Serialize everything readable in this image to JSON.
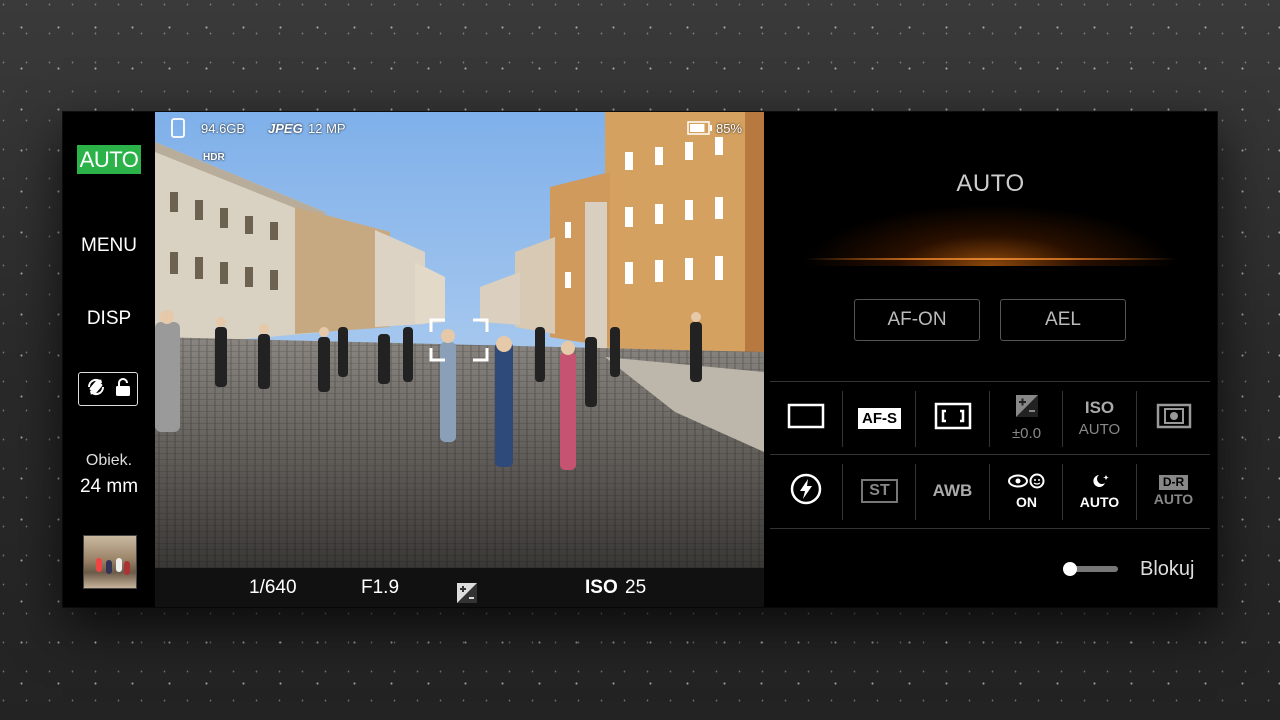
{
  "left": {
    "mode": "AUTO",
    "menu": "MENU",
    "disp": "DISP",
    "lens_label": "Obiek.",
    "lens_value": "24 mm"
  },
  "hud": {
    "storage": "94.6GB",
    "format": "JPEG",
    "resolution": "12 MP",
    "hdr": "HDR",
    "battery": "85%",
    "battery_level": 0.85
  },
  "bottom": {
    "shutter": "1/640",
    "aperture": "F1.9",
    "iso_label": "ISO",
    "iso_value": "25"
  },
  "right": {
    "title": "AUTO",
    "af_on": "AF-ON",
    "ael": "AEL",
    "row1": [
      {
        "name": "drive-mode",
        "icon": "single-frame-icon"
      },
      {
        "name": "focus-mode",
        "label": "AF-S"
      },
      {
        "name": "focus-area",
        "icon": "focus-area-icon"
      },
      {
        "name": "exposure-comp",
        "icon": "exposure-comp-icon",
        "sub": "±0.0"
      },
      {
        "name": "iso",
        "label": "ISO",
        "sub": "AUTO"
      },
      {
        "name": "metering",
        "icon": "metering-icon"
      }
    ],
    "row2": [
      {
        "name": "flash",
        "icon": "flash-icon"
      },
      {
        "name": "style",
        "label": "ST"
      },
      {
        "name": "white-balance",
        "label": "AWB"
      },
      {
        "name": "face-eye",
        "label": "ON"
      },
      {
        "name": "night",
        "label": "AUTO"
      },
      {
        "name": "dro",
        "label": "D-R",
        "sub": "AUTO"
      }
    ],
    "lock_label": "Blokuj"
  },
  "colors": {
    "auto_green": "#2bb34a",
    "glow_orange": "#e08530"
  }
}
